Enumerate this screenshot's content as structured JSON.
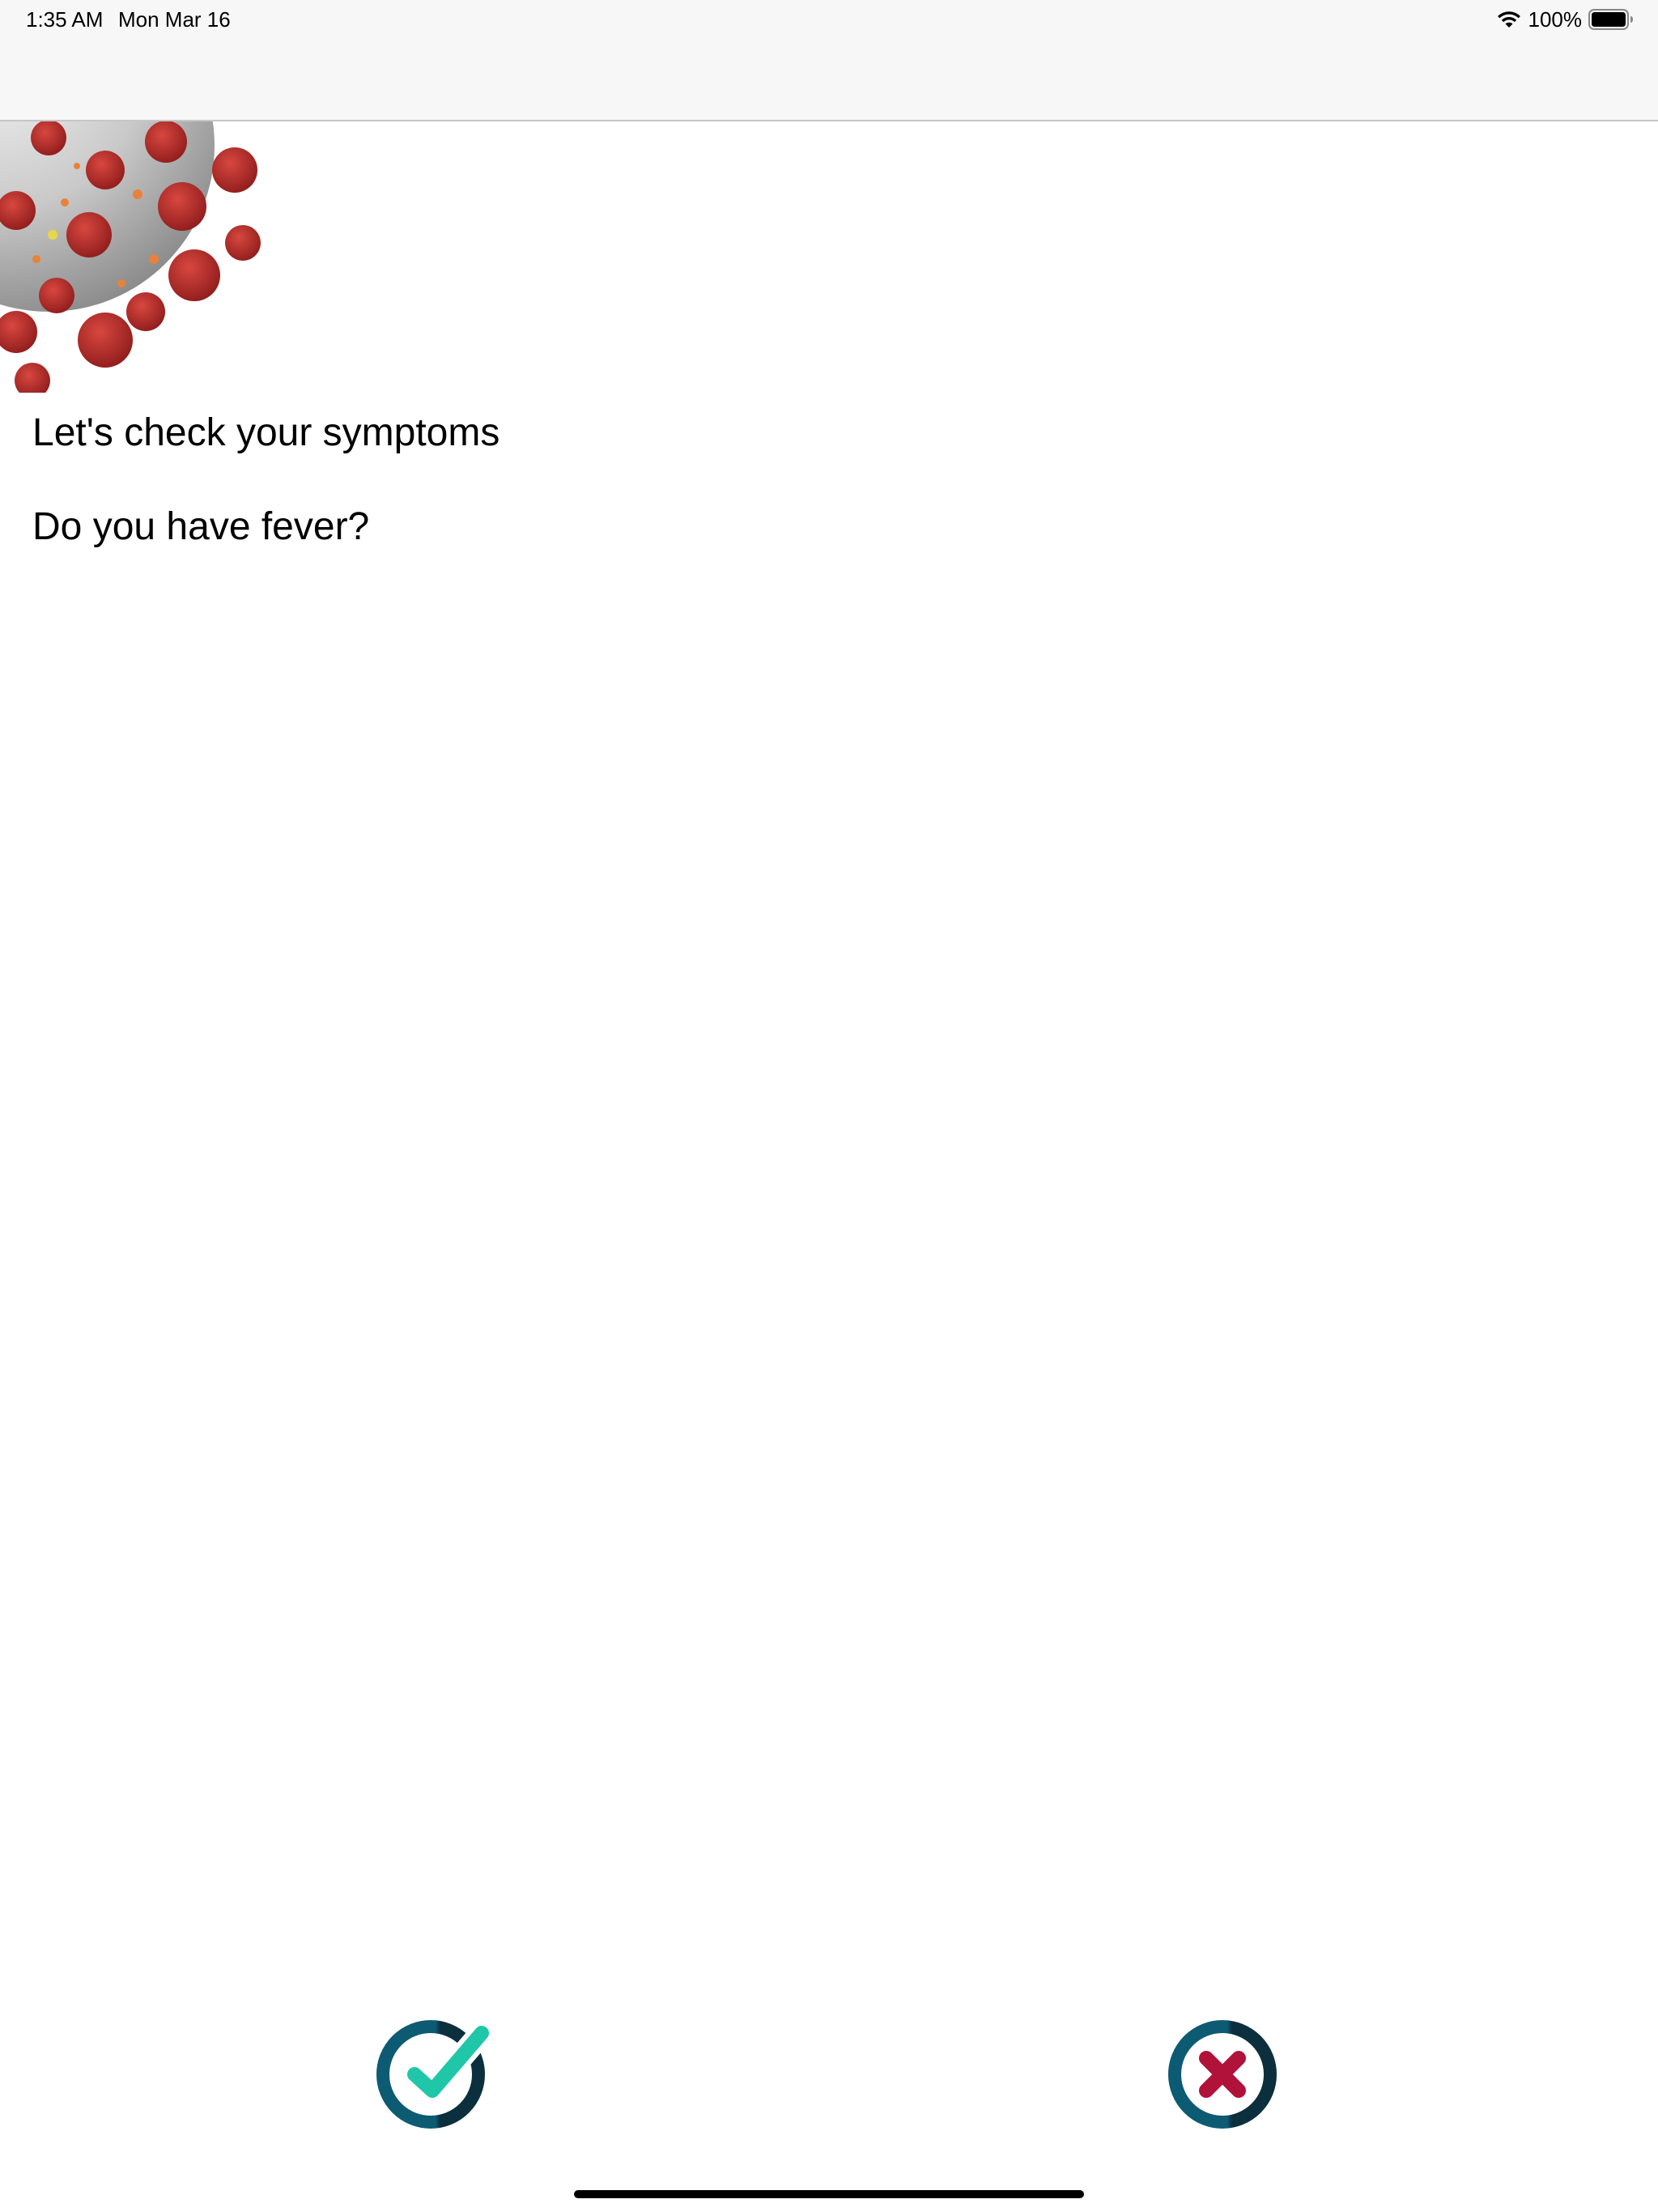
{
  "status_bar": {
    "time": "1:35 AM",
    "date": "Mon Mar 16",
    "battery": "100%",
    "wifi_icon": "wifi-icon",
    "battery_icon": "battery-full-icon"
  },
  "hero": {
    "image": "coronavirus-illustration"
  },
  "content": {
    "heading": "Let's check your symptoms",
    "question": "Do you have fever?"
  },
  "answers": {
    "yes": {
      "icon": "checkmark-circle-icon",
      "color": "#1fc7a8"
    },
    "no": {
      "icon": "x-circle-icon",
      "color": "#b0123a"
    }
  },
  "colors": {
    "ring": "#0d5a73",
    "ring_dark": "#0b2f3d",
    "nav_background": "#f7f7f7"
  }
}
